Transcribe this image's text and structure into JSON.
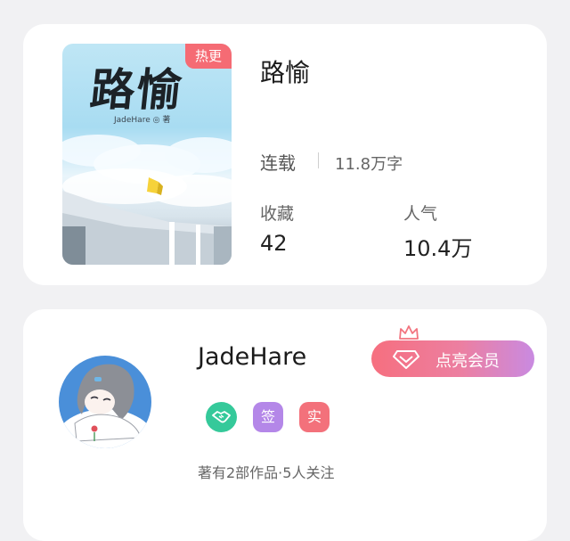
{
  "book": {
    "cover_title": "路愉",
    "cover_author": "JadeHare ◎ 著",
    "hot_badge": "热更",
    "title": "路愉",
    "status": "连载",
    "word_count": "11.8万字",
    "stats": [
      {
        "label": "收藏",
        "value": "42"
      },
      {
        "label": "人气",
        "value": "10.4万"
      }
    ]
  },
  "author": {
    "name": "JadeHare",
    "vip_button_label": "点亮会员",
    "badges": [
      {
        "icon": "handshake-icon",
        "text": ""
      },
      {
        "icon": "",
        "text": "签"
      },
      {
        "icon": "",
        "text": "实"
      }
    ],
    "works_info": "著有2部作品·5人关注"
  },
  "colors": {
    "hot_badge": "#f56b74",
    "vip_gradient_start": "#f66f7f",
    "vip_gradient_end": "#c98ae1",
    "badge_green": "#35c99a",
    "badge_purple": "#b487e8",
    "badge_red": "#f3717b",
    "page_background": "#f1f1f3"
  }
}
